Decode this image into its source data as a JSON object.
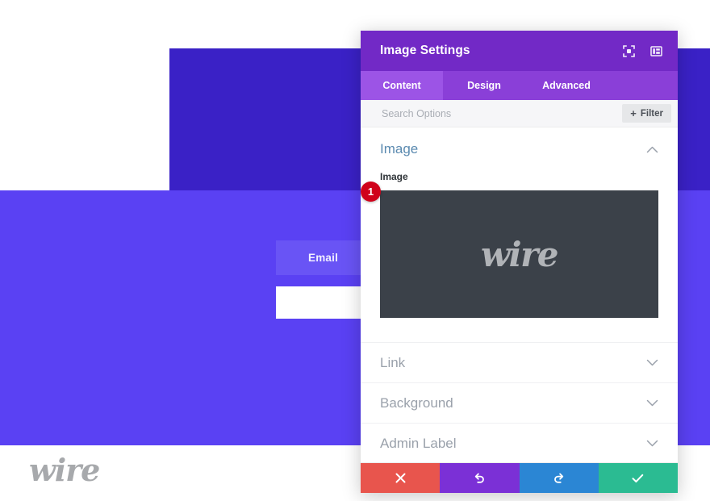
{
  "page": {
    "email_button_label": "Email",
    "footer_logo_text": "wire",
    "colors": {
      "hero_dark": "#3a21c6",
      "hero_light": "#5a41f3",
      "email_button": "#6954f5"
    }
  },
  "modal": {
    "title": "Image Settings",
    "title_icons": [
      {
        "name": "fullscreen-icon",
        "label": "Fullscreen"
      },
      {
        "name": "layout-panel-icon",
        "label": "Change panel layout"
      }
    ],
    "tabs": [
      {
        "label": "Content",
        "active": true
      },
      {
        "label": "Design",
        "active": false
      },
      {
        "label": "Advanced",
        "active": false
      }
    ],
    "search": {
      "placeholder": "Search Options",
      "value": ""
    },
    "filter_button": {
      "plus": "+",
      "label": "Filter"
    },
    "sections": [
      {
        "title": "Image",
        "expanded": true,
        "field_label": "Image",
        "preview_logo_text": "wire",
        "preview_bg": "#3b4149",
        "step_badge": "1"
      },
      {
        "title": "Link",
        "expanded": false
      },
      {
        "title": "Background",
        "expanded": false
      },
      {
        "title": "Admin Label",
        "expanded": false
      }
    ],
    "footer_buttons": [
      {
        "name": "cancel-button",
        "icon": "close-icon",
        "color": "#e8554d"
      },
      {
        "name": "undo-button",
        "icon": "undo-icon",
        "color": "#7b30d6"
      },
      {
        "name": "redo-button",
        "icon": "redo-icon",
        "color": "#2b86d4"
      },
      {
        "name": "save-button",
        "icon": "checkmark-icon",
        "color": "#2bbb92"
      }
    ]
  }
}
